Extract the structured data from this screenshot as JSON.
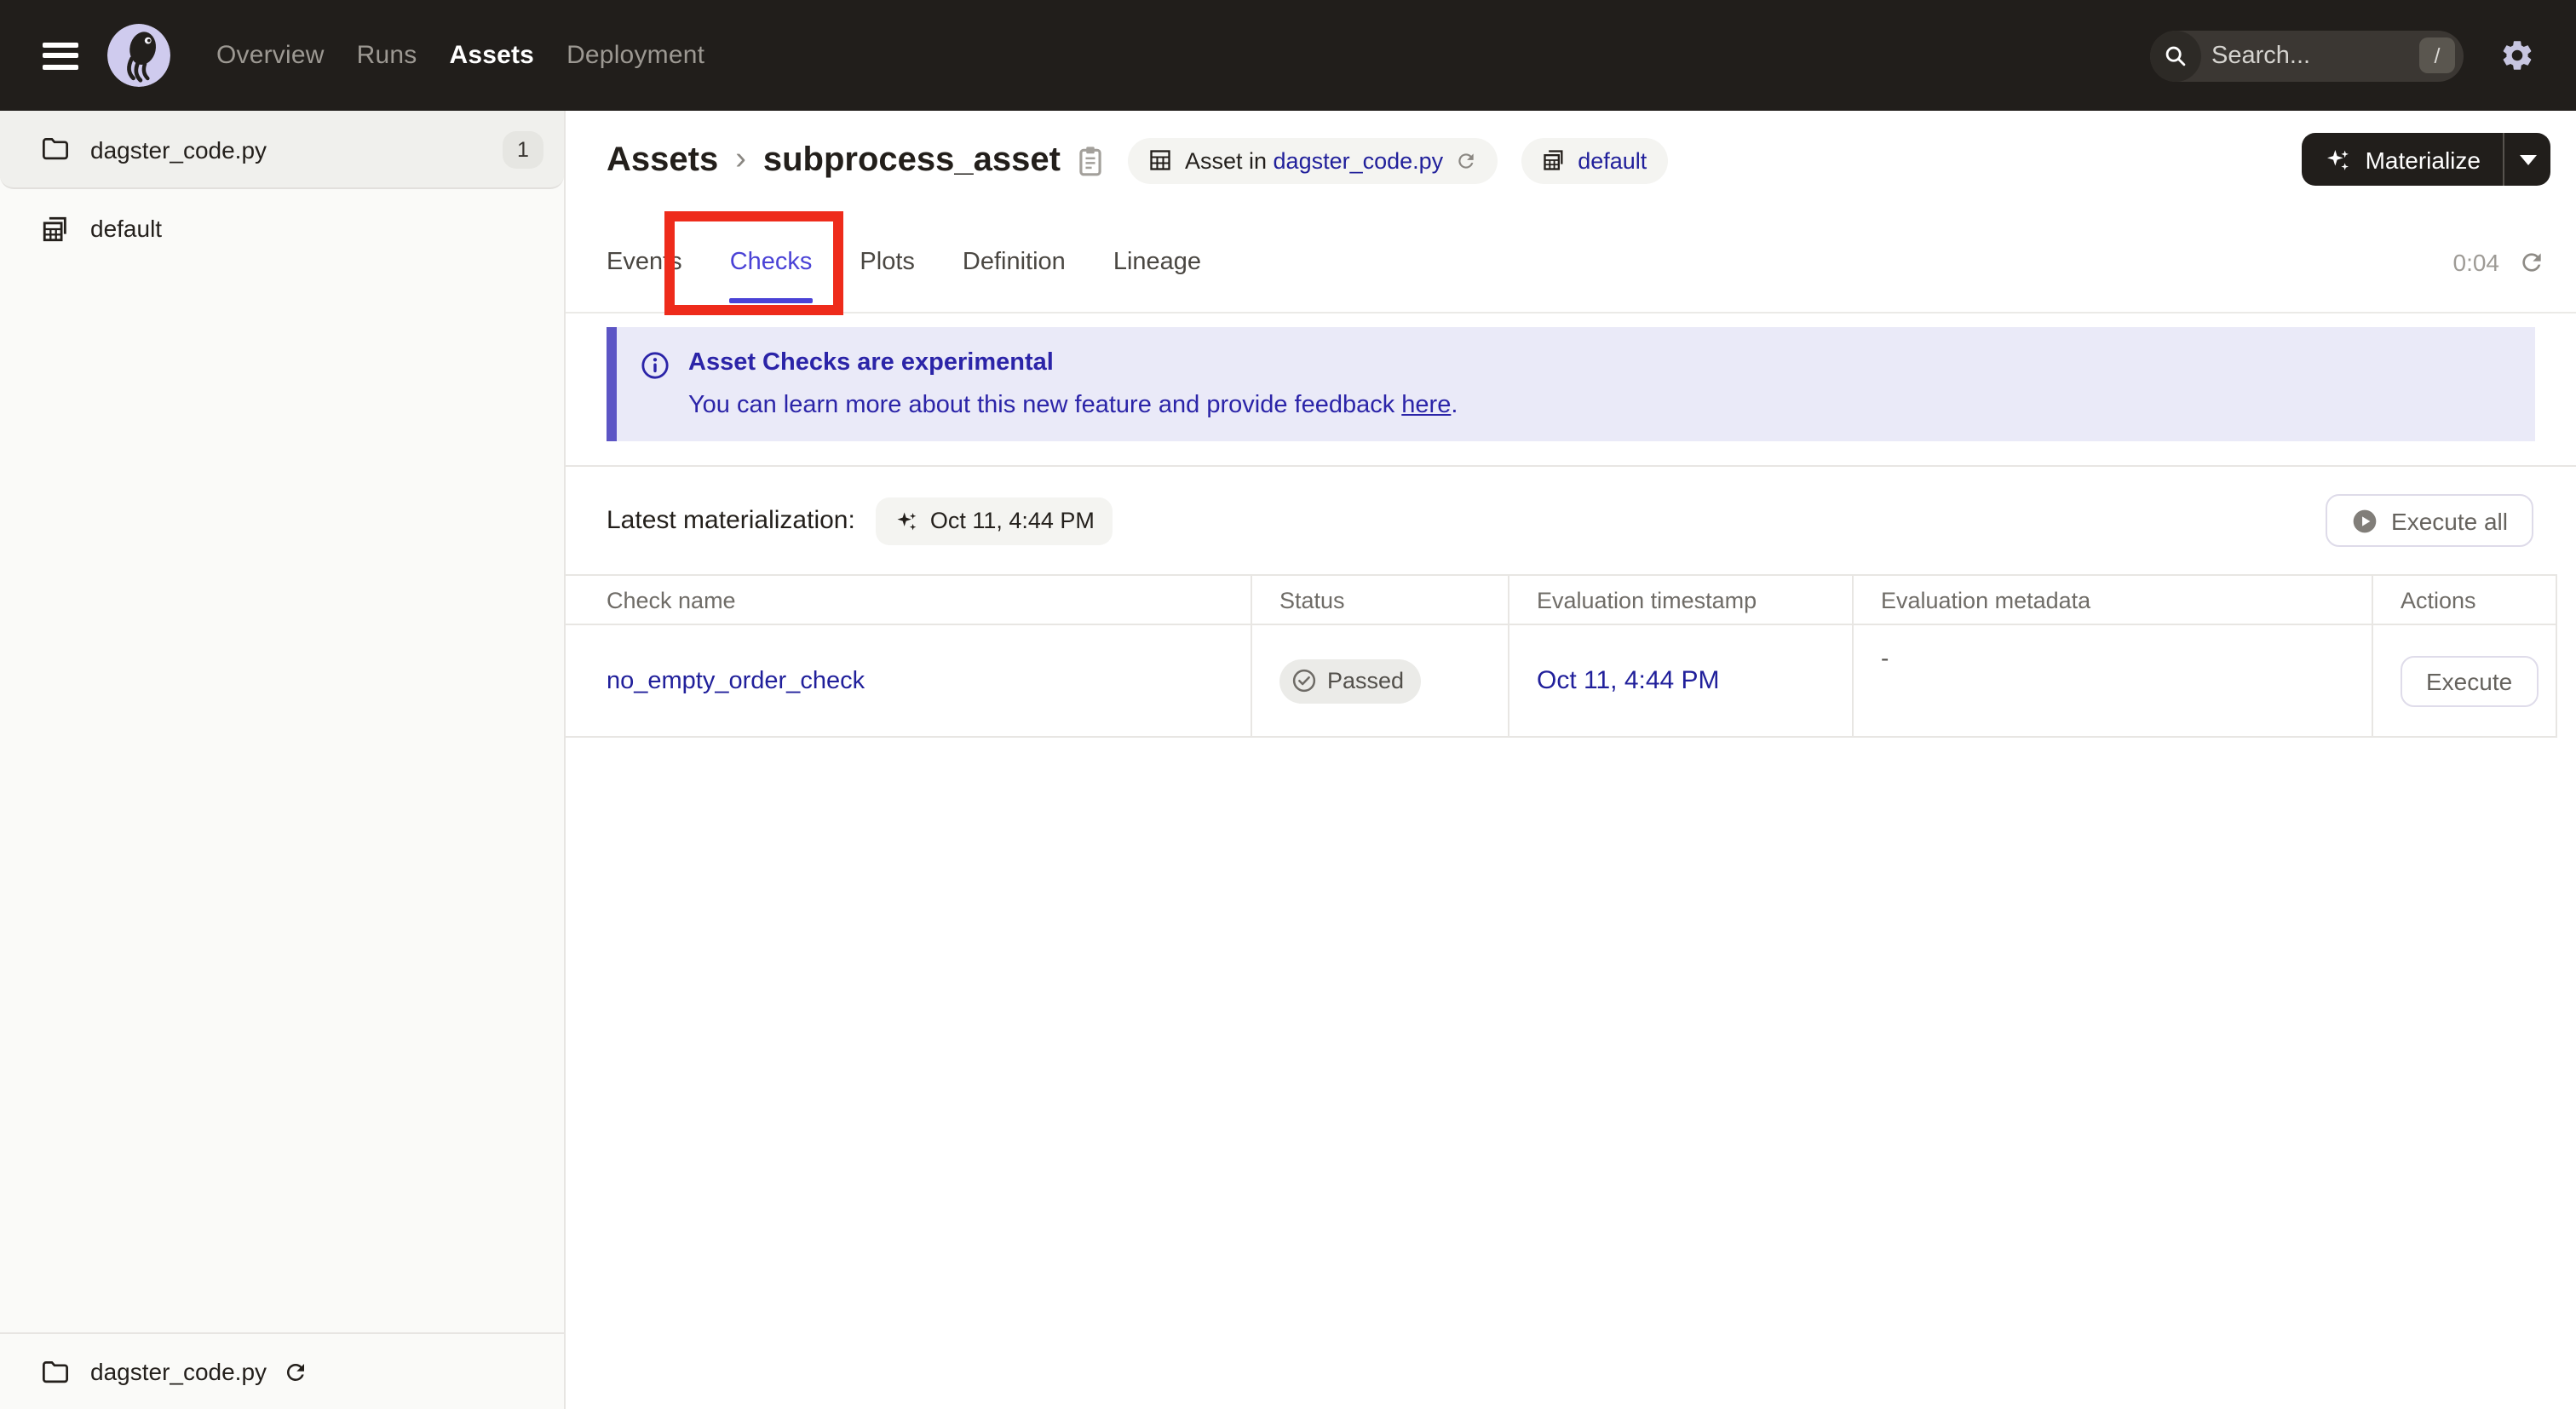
{
  "colors": {
    "nav-bg": "#211E1B",
    "accent": "#4A42D6",
    "link": "#21209B",
    "banner-bg": "#EAEAF8",
    "banner-border": "#5C55C5",
    "banner-text": "#2B24A8",
    "annotation": "#EE2B1B"
  },
  "nav": {
    "items": [
      {
        "label": "Overview"
      },
      {
        "label": "Runs"
      },
      {
        "label": "Assets"
      },
      {
        "label": "Deployment"
      }
    ],
    "active": "Assets",
    "search": {
      "placeholder": "Search...",
      "shortcut": "/"
    }
  },
  "sidebar": {
    "code_location": {
      "label": "dagster_code.py",
      "count": "1"
    },
    "group": {
      "label": "default"
    },
    "footer": {
      "label": "dagster_code.py"
    }
  },
  "header": {
    "breadcrumb": {
      "root": "Assets",
      "separator": "›",
      "current": "subprocess_asset"
    },
    "asset_tag": {
      "prefix": "Asset in ",
      "link": "dagster_code.py"
    },
    "group_tag": {
      "label": "default"
    },
    "materialize": {
      "label": "Materialize"
    }
  },
  "tabs": {
    "items": [
      {
        "label": "Events"
      },
      {
        "label": "Checks"
      },
      {
        "label": "Plots"
      },
      {
        "label": "Definition"
      },
      {
        "label": "Lineage"
      }
    ],
    "active": "Checks",
    "timer": "0:04"
  },
  "banner": {
    "title": "Asset Checks are experimental",
    "body_prefix": "You can learn more about this new feature and provide feedback ",
    "link": "here",
    "suffix": "."
  },
  "materialization": {
    "label": "Latest materialization:",
    "timestamp": "Oct 11, 4:44 PM",
    "execute_all": "Execute all"
  },
  "checks_table": {
    "headers": [
      "Check name",
      "Status",
      "Evaluation timestamp",
      "Evaluation metadata",
      "Actions"
    ],
    "rows": [
      {
        "name": "no_empty_order_check",
        "status": "Passed",
        "timestamp": "Oct 11, 4:44 PM",
        "metadata": "-",
        "action": "Execute"
      }
    ]
  }
}
